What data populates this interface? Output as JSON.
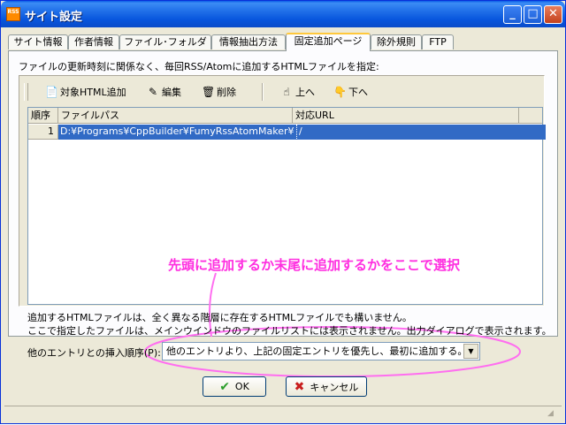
{
  "window": {
    "title": "サイト設定",
    "app_icon_text": "RSS"
  },
  "tabs": [
    {
      "label": "サイト情報"
    },
    {
      "label": "作者情報"
    },
    {
      "label": "ファイル･フォルダ"
    },
    {
      "label": "情報抽出方法"
    },
    {
      "label": "固定追加ページ"
    },
    {
      "label": "除外規則"
    },
    {
      "label": "FTP"
    }
  ],
  "panel": {
    "instruction": "ファイルの更新時刻に関係なく、毎回RSS/Atomに追加するHTMLファイルを指定:"
  },
  "toolbar": {
    "add": "対象HTML追加",
    "edit": "編集",
    "delete": "削除",
    "up": "上へ",
    "down": "下へ"
  },
  "list": {
    "columns": [
      "順序",
      "ファイルパス",
      "対応URL"
    ],
    "rows": [
      {
        "order": "1",
        "path": "D:¥Programs¥CppBuilder¥FumyRssAtomMaker¥HELP¥...",
        "url": "/"
      }
    ]
  },
  "notes": {
    "line1": "追加するHTMLファイルは、全く異なる階層に存在するHTMLファイルでも構いません。",
    "line2": "ここで指定したファイルは、メインウインドウのファイルリストには表示されません。出力ダイアログで表示されます。"
  },
  "annotation": {
    "text": "先頭に追加するか末尾に追加するかをここで選択",
    "color": "#ff2ee0"
  },
  "insert_order": {
    "label": "他のエントリとの挿入順序(P):",
    "value": "他のエントリより、上記の固定エントリを優先し、最初に追加する。"
  },
  "buttons": {
    "ok": "OK",
    "cancel": "キャンセル"
  },
  "colors": {
    "selection": "#316ac5",
    "accent": "#ff2ee0"
  }
}
